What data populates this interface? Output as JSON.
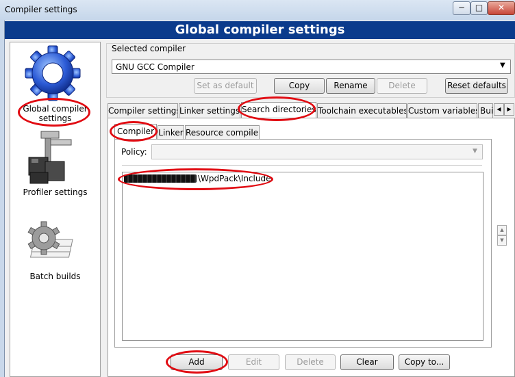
{
  "window": {
    "title": "Compiler settings",
    "header": "Global compiler settings"
  },
  "sidebar": {
    "items": [
      {
        "label_line1": "Global compiler",
        "label_line2": "settings"
      },
      {
        "label": "Profiler settings"
      },
      {
        "label": "Batch builds"
      }
    ]
  },
  "compiler": {
    "section_label": "Selected compiler",
    "selected": "GNU GCC Compiler"
  },
  "actions": {
    "set_default": "Set as default",
    "copy": "Copy",
    "rename": "Rename",
    "delete": "Delete",
    "reset_defaults": "Reset defaults"
  },
  "tabs": [
    {
      "label": "Compiler settings"
    },
    {
      "label": "Linker settings"
    },
    {
      "label": "Search directories"
    },
    {
      "label": "Toolchain executables"
    },
    {
      "label": "Custom variables"
    },
    {
      "label": "Bui"
    }
  ],
  "subtabs": [
    {
      "label": "Compiler"
    },
    {
      "label": "Linker"
    },
    {
      "label": "Resource compiler"
    }
  ],
  "policy": {
    "label": "Policy:",
    "value": ""
  },
  "directories": {
    "entry_suffix": "\\WpdPack\\Include"
  },
  "bottom_buttons": {
    "add": "Add",
    "edit": "Edit",
    "delete": "Delete",
    "clear": "Clear",
    "copy_to": "Copy to..."
  }
}
